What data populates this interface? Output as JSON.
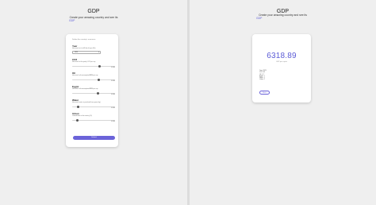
{
  "left": {
    "title": "GDP",
    "subtitle": "Create your amazing country and see its",
    "link": "GDP",
    "form": {
      "heading": "Define the country's resources",
      "questions": [
        {
          "label": "Year",
          "desc": "How much is it to fill this all your fill in",
          "select": "2023"
        },
        {
          "label": "CO2",
          "desc": "How much is the yearly CO2 per cap",
          "value": 0.65,
          "display": "0.0000"
        },
        {
          "label": "Oil",
          "desc": "How much oil consumption/BBM per cap",
          "value": 0.62,
          "display": "0.0000"
        },
        {
          "label": "Egypt",
          "desc": "How much oil consumption/BBM per cap",
          "value": 0.6,
          "display": "0.0000"
        },
        {
          "label": "Water",
          "desc": "How much water is produced from yours (kg)",
          "value": 0.12,
          "display": "0.0000"
        },
        {
          "label": "Urban",
          "desc": "Urbanization in this country (%)",
          "value": 0.1,
          "display": "0.0000"
        }
      ],
      "submit_label": "Submit"
    }
  },
  "right": {
    "title": "GDP",
    "subtitle": "Create your amazing country and see its",
    "link": "GDP",
    "result": {
      "value": "6318.89",
      "unit": "GDP per capita",
      "summary": [
        "Year: 2023",
        "CO2: 36",
        "Oil: 4.7",
        "Egypt: 1",
        "Water: 1",
        "Urban: 1"
      ],
      "back_label": "Back"
    }
  }
}
